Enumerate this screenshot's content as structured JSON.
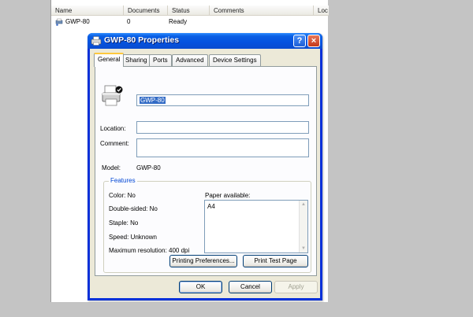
{
  "explorer": {
    "columns": [
      "Name",
      "Documents",
      "Status",
      "Comments",
      "Loc"
    ],
    "row": {
      "name": "GWP-80",
      "documents": "0",
      "status": "Ready",
      "comments": ""
    }
  },
  "dialog": {
    "title": "GWP-80 Properties",
    "help_label": "?",
    "close_label": "×",
    "tabs": [
      "General",
      "Sharing",
      "Ports",
      "Advanced",
      "Device Settings"
    ],
    "active_tab": "General",
    "printer_name": "GWP-80",
    "location_label": "Location:",
    "location_value": "",
    "comment_label": "Comment:",
    "comment_value": "",
    "model_label": "Model:",
    "model_value": "GWP-80",
    "features": {
      "legend": "Features",
      "color": "Color: No",
      "double_sided": "Double-sided: No",
      "staple": "Staple: No",
      "speed": "Speed: Unknown",
      "max_resolution": "Maximum resolution: 400 dpi",
      "paper_label": "Paper available:",
      "paper_items": [
        "A4"
      ]
    },
    "buttons": {
      "printing_preferences": "Printing Preferences...",
      "print_test_page": "Print Test Page",
      "ok": "OK",
      "cancel": "Cancel",
      "apply": "Apply"
    }
  }
}
